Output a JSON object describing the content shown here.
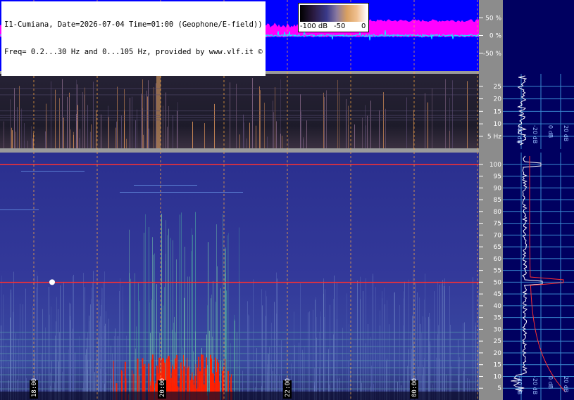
{
  "info": {
    "line1": "I1-Cumiana, Date=2026-07-04 Time=01:00 (Geophone/E-field))",
    "line2": "Freq= 0.2...30 Hz and 0...105 Hz, provided by www.vlf.it ©"
  },
  "colorbar": {
    "labels": [
      "-100 dB",
      "-50",
      "0"
    ]
  },
  "chart_data": [
    {
      "type": "line",
      "title": "",
      "y_ticks": [
        50,
        0,
        -50
      ],
      "y_unit": "%",
      "y_tick_labels": [
        "50 %",
        "0 %",
        "-50 %"
      ],
      "ylim": [
        -100,
        100
      ],
      "colors": {
        "background": "#0000ff",
        "envelope": "#ff00ff",
        "trace": "#00ffff"
      }
    },
    {
      "type": "heatmap",
      "title": "",
      "y_ticks": [
        5,
        10,
        15,
        20,
        25
      ],
      "y_tick_labels": [
        "5 Hz",
        "10",
        "15",
        "20",
        "25"
      ],
      "ylim": [
        0.2,
        30
      ],
      "spectrum_ticks": [
        "-40 dB",
        "-20 dB",
        "0 dB",
        "20 dB"
      ]
    },
    {
      "type": "heatmap",
      "title": "",
      "y_ticks": [
        5,
        10,
        15,
        20,
        25,
        30,
        35,
        40,
        45,
        50,
        55,
        60,
        65,
        70,
        75,
        80,
        85,
        90,
        95,
        100
      ],
      "ylim": [
        0,
        105
      ],
      "x_tick_labels": [
        "18:00",
        "20:00",
        "22:00",
        "00:00"
      ],
      "spectrum_ticks": [
        "-40 dB",
        "-20 dB",
        "0 dB",
        "20 dB"
      ],
      "lines_hz": [
        50,
        100
      ]
    }
  ]
}
